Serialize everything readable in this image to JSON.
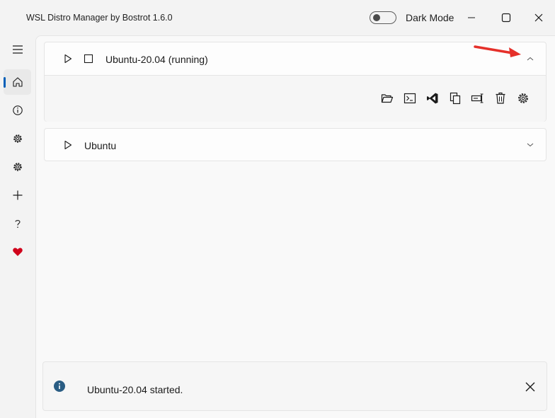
{
  "window": {
    "title": "WSL Distro Manager by Bostrot 1.6.0",
    "dark_mode_label": "Dark Mode",
    "dark_mode_on": false
  },
  "sidebar": {
    "items": [
      {
        "name": "home",
        "icon": "home-icon",
        "active": true
      },
      {
        "name": "info",
        "icon": "info-icon"
      },
      {
        "name": "settings",
        "icon": "gear-icon"
      },
      {
        "name": "advanced-settings",
        "icon": "gear-icon"
      },
      {
        "name": "add",
        "icon": "plus-icon"
      },
      {
        "name": "help",
        "icon": "question-icon"
      },
      {
        "name": "donate",
        "icon": "heart-icon",
        "color": "#d0021b"
      }
    ]
  },
  "distros": [
    {
      "name": "Ubuntu-20.04 (running)",
      "expanded": true,
      "running": true,
      "actions": [
        "open-folder",
        "open-terminal",
        "open-vscode",
        "copy",
        "rename",
        "delete",
        "settings"
      ]
    },
    {
      "name": "Ubuntu",
      "expanded": false,
      "running": false
    }
  ],
  "notification": {
    "message": "Ubuntu-20.04 started.",
    "icon": "info-icon",
    "icon_color": "#2a5d84"
  },
  "colors": {
    "accent": "#005fb8",
    "arrow": "#e5302a"
  }
}
